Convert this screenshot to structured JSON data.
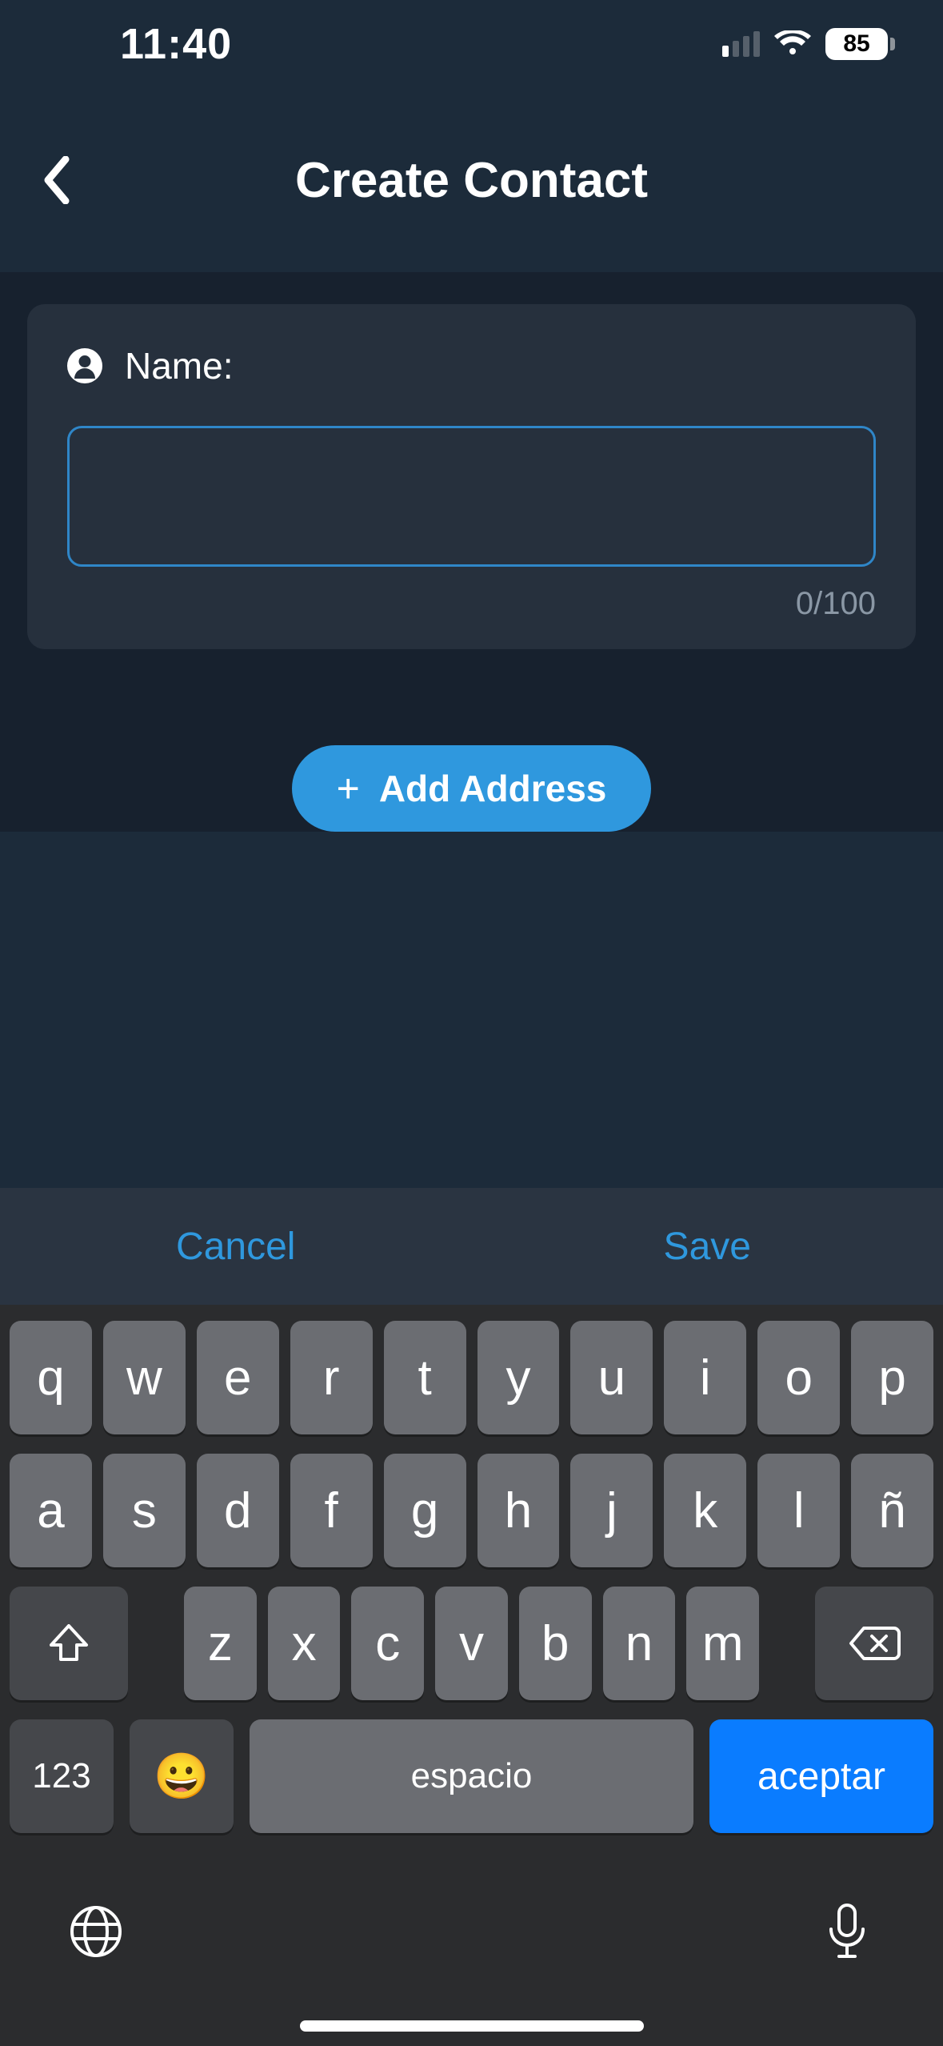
{
  "status": {
    "time": "11:40",
    "battery": "85"
  },
  "header": {
    "title": "Create Contact"
  },
  "form": {
    "name_label": "Name:",
    "name_value": "",
    "counter": "0/100"
  },
  "buttons": {
    "add_address": "Add Address"
  },
  "kbd_toolbar": {
    "cancel": "Cancel",
    "save": "Save"
  },
  "kbd": {
    "row1": [
      "q",
      "w",
      "e",
      "r",
      "t",
      "y",
      "u",
      "i",
      "o",
      "p"
    ],
    "row2": [
      "a",
      "s",
      "d",
      "f",
      "g",
      "h",
      "j",
      "k",
      "l",
      "ñ"
    ],
    "row3": [
      "z",
      "x",
      "c",
      "v",
      "b",
      "n",
      "m"
    ],
    "num": "123",
    "emoji": "😀",
    "space": "espacio",
    "accept": "aceptar"
  }
}
